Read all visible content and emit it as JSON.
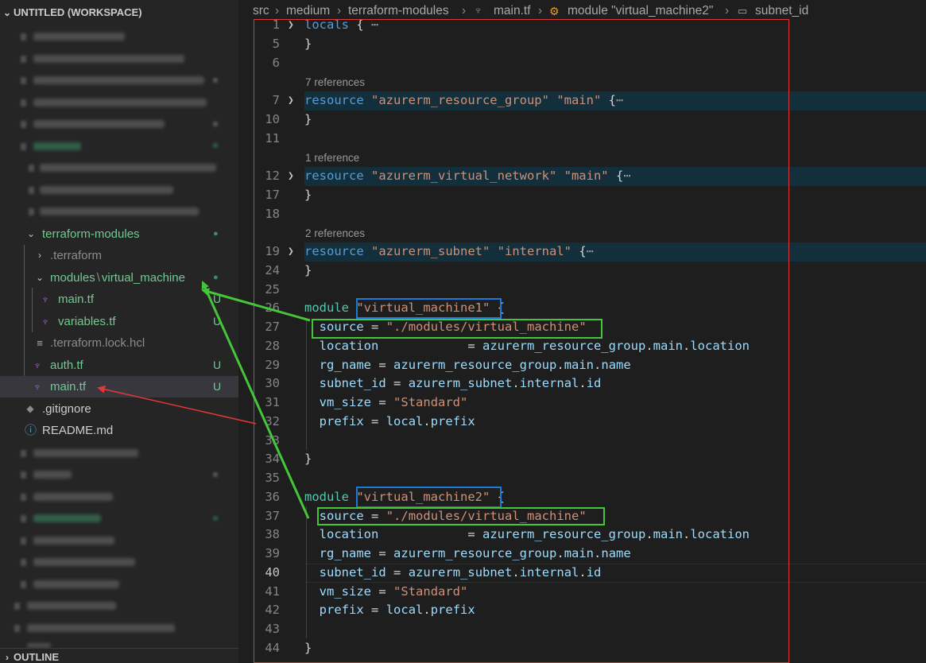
{
  "sidebar": {
    "workspace_title": "UNTITLED (WORKSPACE)",
    "outline_title": "OUTLINE",
    "tree": {
      "terraform_modules": "terraform-modules",
      "dot_terraform": ".terraform",
      "modules_path_1": "modules",
      "modules_path_sep": "\\",
      "modules_path_2": "virtual_machine",
      "vm_main_tf": "main.tf",
      "vm_variables_tf": "variables.tf",
      "lock_file": ".terraform.lock.hcl",
      "auth_tf": "auth.tf",
      "main_tf": "main.tf",
      "gitignore": ".gitignore",
      "readme": "README.md",
      "untracked_badge": "U",
      "modified_dot": "●"
    }
  },
  "breadcrumb": {
    "items": [
      "src",
      "medium",
      "terraform-modules",
      "main.tf",
      "module \"virtual_machine2\"",
      "subnet_id"
    ],
    "separator": "›"
  },
  "editor": {
    "references": [
      "7 references",
      "1 reference",
      "2 references"
    ],
    "line_numbers": [
      "1",
      "5",
      "6",
      "7",
      "10",
      "11",
      "12",
      "17",
      "18",
      "19",
      "24",
      "25",
      "26",
      "27",
      "28",
      "29",
      "30",
      "31",
      "32",
      "33",
      "34",
      "35",
      "36",
      "37",
      "38",
      "39",
      "40",
      "41",
      "42",
      "43",
      "44"
    ],
    "current_line": "40",
    "code": {
      "locals": "locals",
      "fold_dots": "⋯",
      "resource": "resource",
      "module": "module",
      "rg_type": "\"azurerm_resource_group\"",
      "vnet_type": "\"azurerm_virtual_network\"",
      "subnet_type": "\"azurerm_subnet\"",
      "main_name": "\"main\"",
      "internal_name": "\"internal\"",
      "vm1_name": "\"virtual_machine1\"",
      "vm2_name": "\"virtual_machine2\"",
      "source_key": "source",
      "source_val": "\"./modules/virtual_machine\"",
      "location_key": "location",
      "location_val_1": "azurerm_resource_group",
      "location_val_2": "main",
      "location_val_3": "location",
      "rg_key": "rg_name",
      "rg_val_3": "name",
      "subnet_key": "subnet_id",
      "subnet_val_1": "azurerm_subnet",
      "subnet_val_2": "internal",
      "subnet_val_3": "id",
      "vmsize_key": "vm_size",
      "vmsize_val": "\"Standard\"",
      "prefix_key": "prefix",
      "prefix_val_1": "local",
      "prefix_val_2": "prefix"
    }
  },
  "colors": {
    "keyword": "#569cd6",
    "string": "#ce9178",
    "variable": "#9cdcfe",
    "module_keyword": "#4ec9b0",
    "annotation_red": "#e03838",
    "annotation_blue": "#1e78d7",
    "annotation_green": "#45c63a"
  }
}
